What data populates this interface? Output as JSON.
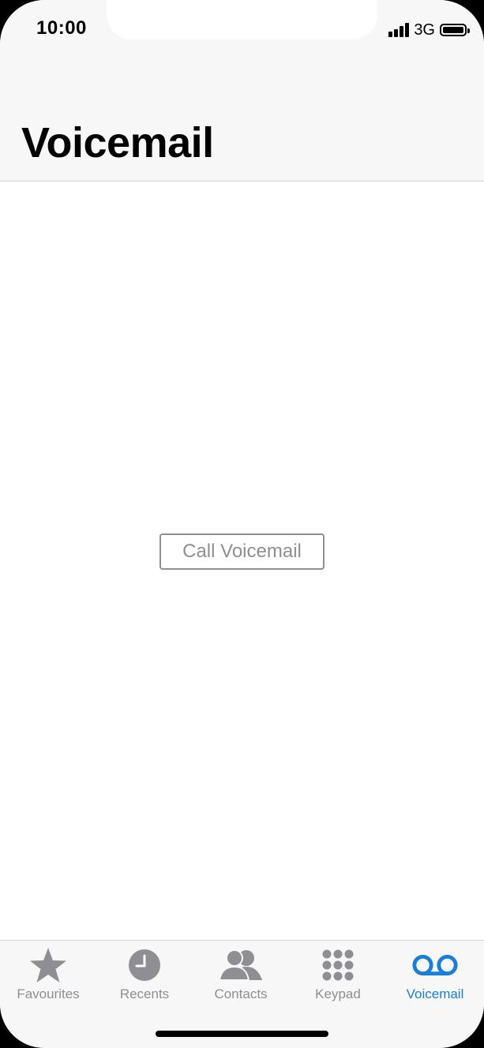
{
  "status_bar": {
    "time": "10:00",
    "network": "3G"
  },
  "header": {
    "title": "Voicemail"
  },
  "main": {
    "call_voicemail_label": "Call Voicemail"
  },
  "tab_bar": {
    "tabs": [
      {
        "label": "Favourites",
        "icon": "star-icon",
        "active": false
      },
      {
        "label": "Recents",
        "icon": "clock-icon",
        "active": false
      },
      {
        "label": "Contacts",
        "icon": "contacts-icon",
        "active": false
      },
      {
        "label": "Keypad",
        "icon": "keypad-icon",
        "active": false
      },
      {
        "label": "Voicemail",
        "icon": "voicemail-icon",
        "active": true
      }
    ]
  },
  "colors": {
    "accent": "#1a7fd4",
    "inactive": "#8e8e93",
    "bar_background": "#f7f7f7"
  }
}
